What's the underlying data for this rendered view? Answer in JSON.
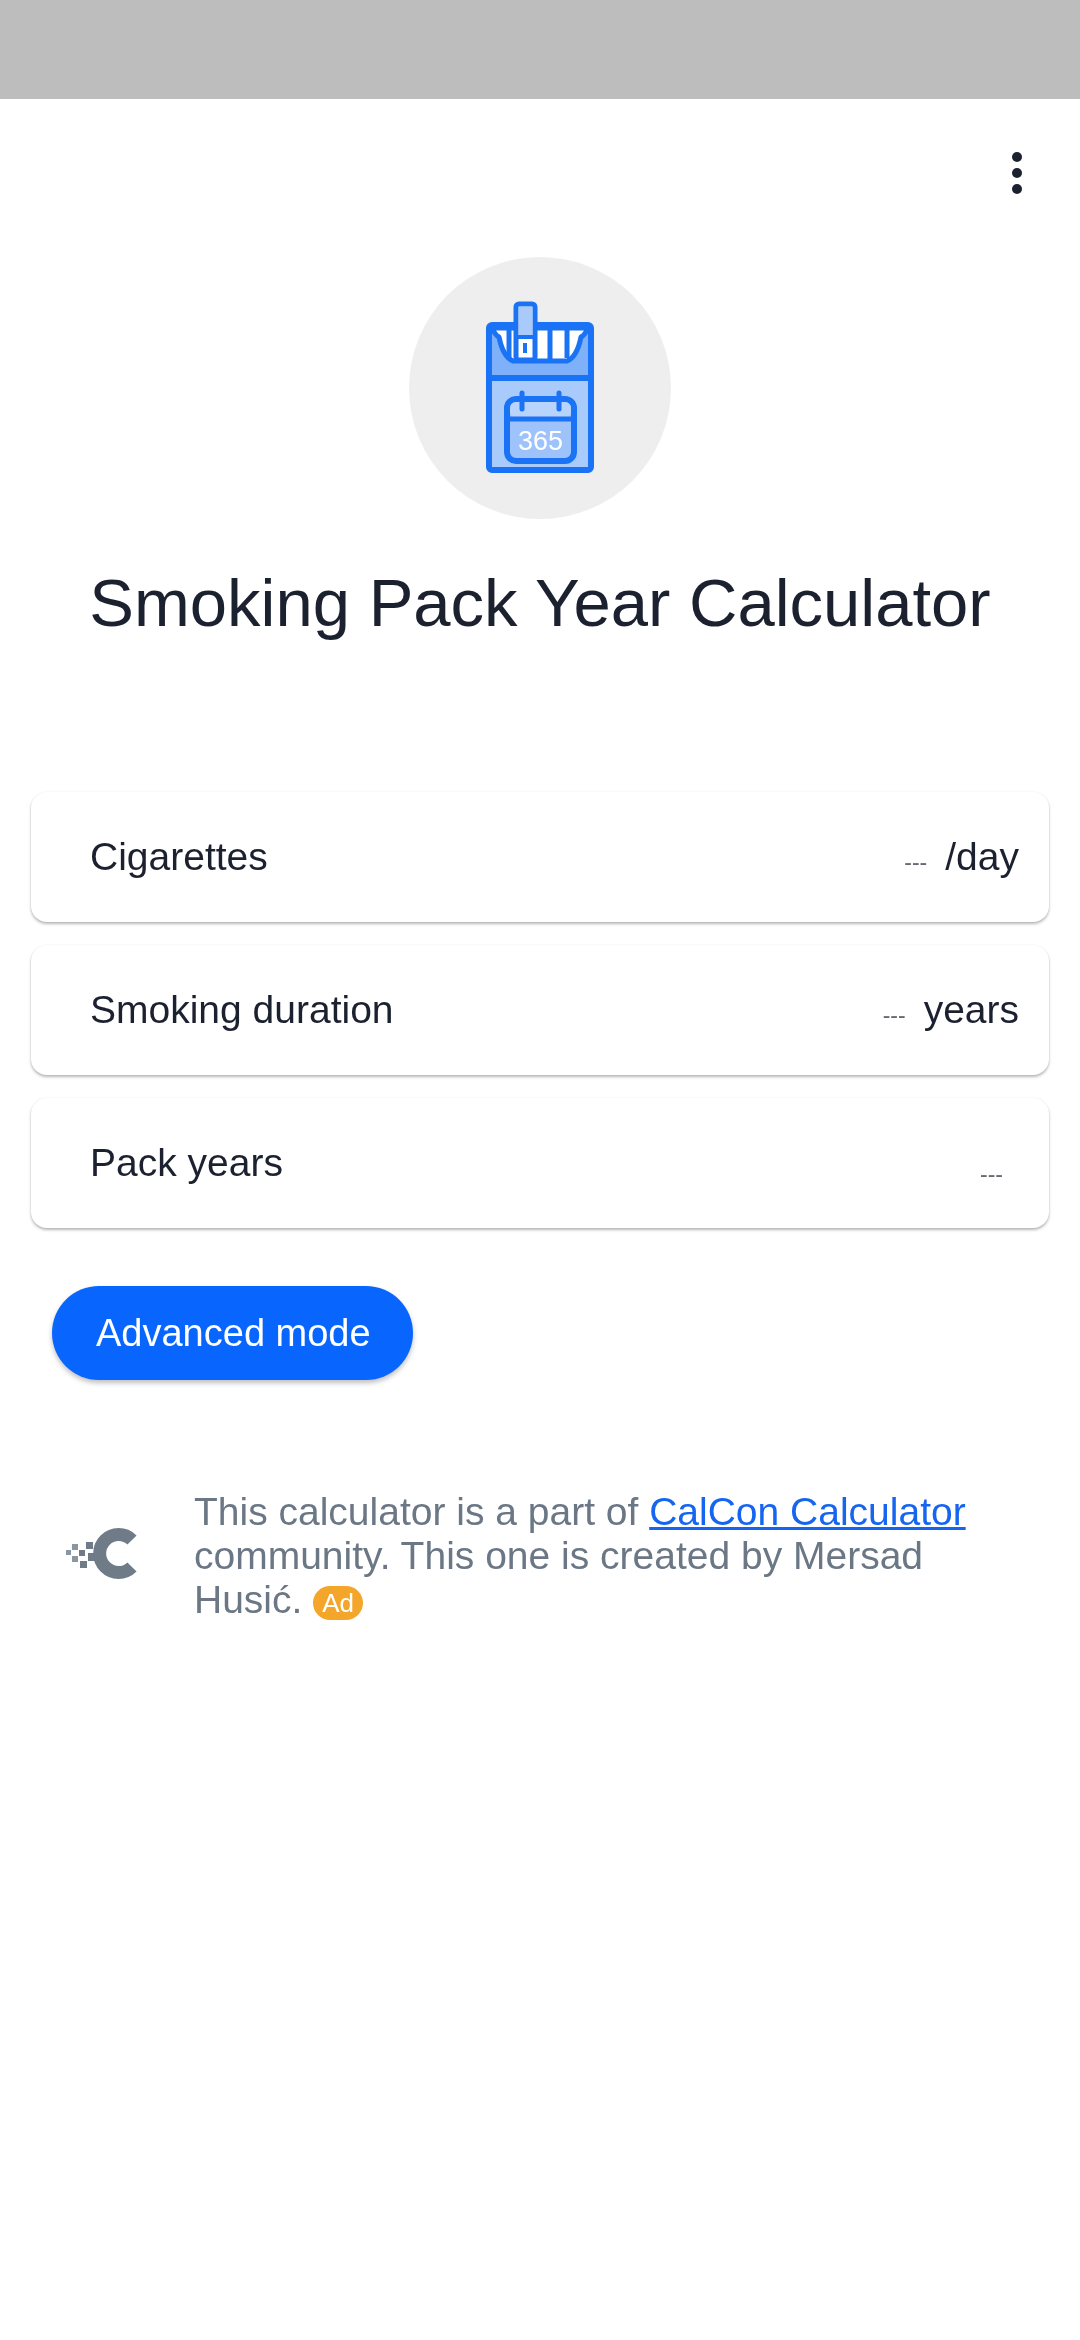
{
  "header": {
    "title": "Smoking Pack Year Calculator",
    "icon_text": "365"
  },
  "fields": [
    {
      "kind": "input",
      "label": "Cigarettes",
      "placeholder": "---",
      "unit": "/day"
    },
    {
      "kind": "input",
      "label": "Smoking duration",
      "placeholder": "---",
      "unit": "years"
    },
    {
      "kind": "result",
      "label": "Pack years",
      "placeholder": "---"
    }
  ],
  "advanced_button": {
    "label": "Advanced mode"
  },
  "footer": {
    "text": "This calculator is a part of",
    "link": "CalCon Calculator",
    "text_after": "community. This one is created by Mersad Husić.",
    "badge": "Ad"
  }
}
